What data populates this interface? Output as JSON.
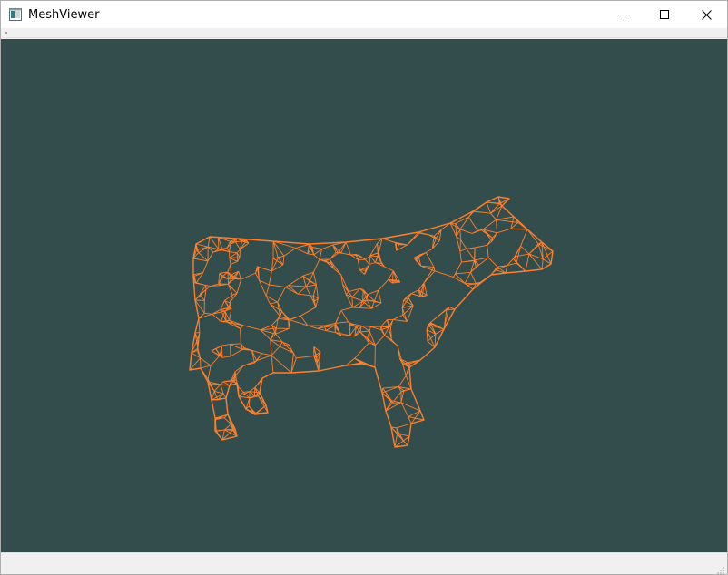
{
  "window": {
    "title": "MeshViewer",
    "icons": {
      "app": "app-window-icon",
      "minimize": "minimize-icon",
      "maximize": "maximize-icon",
      "close": "close-icon"
    }
  },
  "viewport": {
    "background": "#334d4d",
    "wireframe_color": "#ff7f2a",
    "model_subject": "cow"
  }
}
